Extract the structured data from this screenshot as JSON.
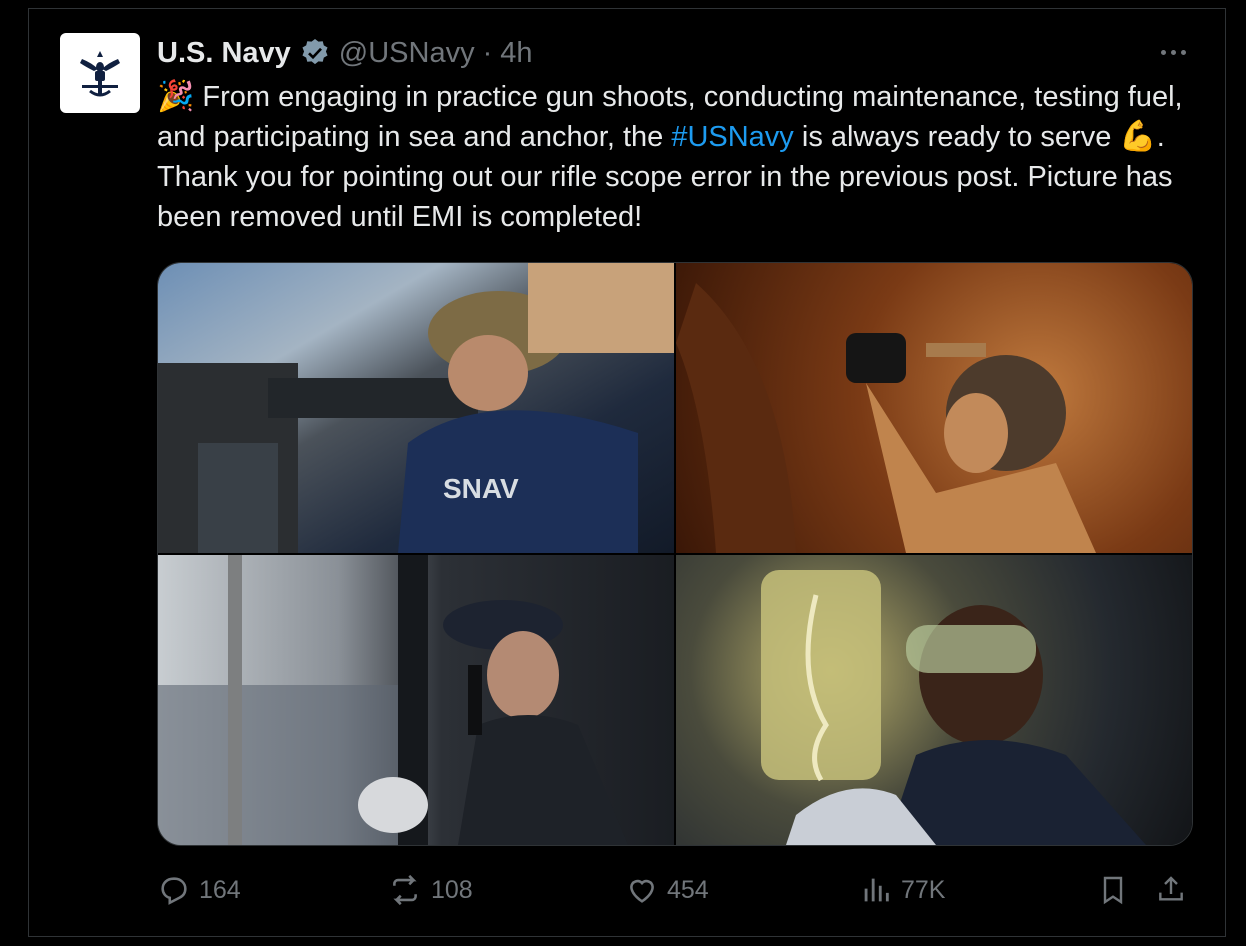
{
  "tweet": {
    "author_name": "U.S. Navy",
    "handle": "@USNavy",
    "separator": "·",
    "time": "4h",
    "text_part1": "From engaging in practice gun shoots, conducting maintenance, testing fuel, and participating in sea and anchor, the ",
    "hashtag": "#USNavy",
    "text_part2": " is always ready to serve ",
    "text_part3": ". Thank you for pointing out our rifle scope error in the previous post. Picture has been removed until EMI is completed!",
    "emoji_start": "🎉",
    "emoji_mid": "💪",
    "stats": {
      "replies": "164",
      "reposts": "108",
      "likes": "454",
      "views": "77K"
    }
  },
  "icons": {
    "avatar": "navy-emblem-icon",
    "verified": "verified-badge-icon",
    "more": "more-icon",
    "reply": "reply-icon",
    "repost": "repost-icon",
    "like": "heart-icon",
    "views": "views-icon",
    "bookmark": "bookmark-icon",
    "share": "share-icon"
  },
  "colors": {
    "background": "#000000",
    "text": "#e7e9ea",
    "muted": "#71767b",
    "link": "#1d9bf0",
    "border": "#2f3336"
  }
}
